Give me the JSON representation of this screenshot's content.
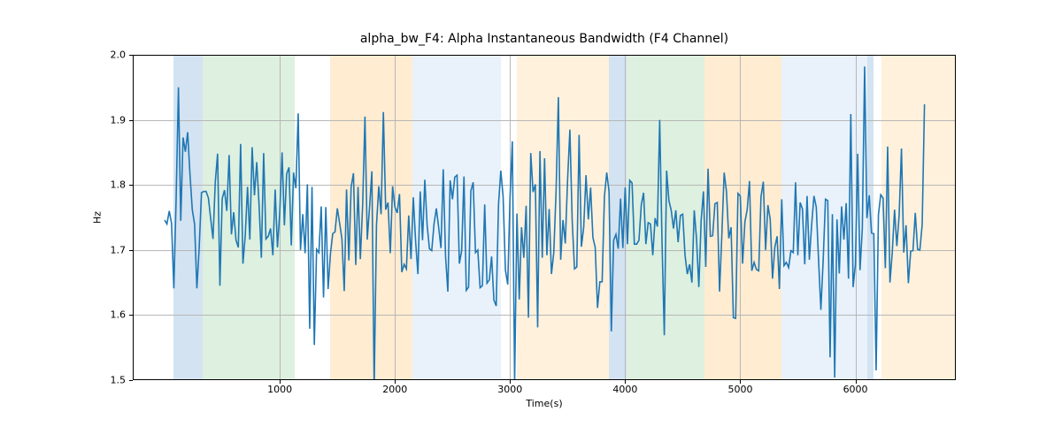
{
  "chart_data": {
    "type": "line",
    "title": "alpha_bw_F4: Alpha Instantaneous Bandwidth (F4 Channel)",
    "xlabel": "Time(s)",
    "ylabel": "Hz",
    "xlim": [
      -277,
      6872
    ],
    "ylim": [
      1.5,
      2.0
    ],
    "xticks": [
      1000,
      2000,
      3000,
      4000,
      5000,
      6000
    ],
    "yticks": [
      1.5,
      1.6,
      1.7,
      1.8,
      1.9,
      2.0
    ],
    "bands": [
      {
        "start": 80,
        "end": 330,
        "color": "#c6d9ec",
        "alpha": 0.75
      },
      {
        "start": 330,
        "end": 1130,
        "color": "#c8e6c9",
        "alpha": 0.6
      },
      {
        "start": 1440,
        "end": 2150,
        "color": "#ffe0b2",
        "alpha": 0.6
      },
      {
        "start": 2150,
        "end": 2920,
        "color": "#dbe9f6",
        "alpha": 0.6
      },
      {
        "start": 3060,
        "end": 3860,
        "color": "#ffe0b2",
        "alpha": 0.45
      },
      {
        "start": 3860,
        "end": 4010,
        "color": "#c6d9ec",
        "alpha": 0.75
      },
      {
        "start": 4010,
        "end": 4690,
        "color": "#c8e6c9",
        "alpha": 0.6
      },
      {
        "start": 4690,
        "end": 5360,
        "color": "#ffe0b2",
        "alpha": 0.6
      },
      {
        "start": 5360,
        "end": 6100,
        "color": "#dbe9f6",
        "alpha": 0.6
      },
      {
        "start": 6100,
        "end": 6160,
        "color": "#c6d9ec",
        "alpha": 0.75
      },
      {
        "start": 6230,
        "end": 6872,
        "color": "#ffe0b2",
        "alpha": 0.45
      }
    ],
    "series": [
      {
        "name": "alpha_bw_F4",
        "color": "#1f77b4",
        "x": [
          0,
          20,
          40,
          60,
          80,
          100,
          120,
          140,
          160,
          180,
          200,
          220,
          240,
          260,
          280,
          300,
          320,
          340,
          360,
          380,
          400,
          420,
          440,
          460,
          480,
          500,
          520,
          540,
          560,
          580,
          600,
          620,
          640,
          660,
          680,
          700,
          720,
          740,
          760,
          780,
          800,
          820,
          840,
          860,
          880,
          900,
          920,
          940,
          960,
          980,
          1000,
          1020,
          1040,
          1060,
          1080,
          1100,
          1120,
          1140,
          1160,
          1180,
          1200,
          1220,
          1240,
          1260,
          1280,
          1300,
          1320,
          1340,
          1360,
          1380,
          1400,
          1420,
          1440,
          1460,
          1480,
          1500,
          1520,
          1540,
          1560,
          1580,
          1600,
          1620,
          1640,
          1660,
          1680,
          1700,
          1720,
          1740,
          1760,
          1780,
          1800,
          1820,
          1840,
          1860,
          1880,
          1900,
          1920,
          1940,
          1960,
          1980,
          2000,
          2020,
          2040,
          2060,
          2080,
          2100,
          2120,
          2140,
          2160,
          2180,
          2200,
          2220,
          2240,
          2260,
          2280,
          2300,
          2320,
          2340,
          2360,
          2380,
          2400,
          2420,
          2440,
          2460,
          2480,
          2500,
          2520,
          2540,
          2560,
          2580,
          2600,
          2620,
          2640,
          2660,
          2680,
          2700,
          2720,
          2740,
          2760,
          2780,
          2800,
          2820,
          2840,
          2860,
          2880,
          2900,
          2920,
          2940,
          2960,
          2980,
          3000,
          3020,
          3040,
          3060,
          3080,
          3100,
          3120,
          3140,
          3160,
          3180,
          3200,
          3220,
          3240,
          3260,
          3280,
          3300,
          3320,
          3340,
          3360,
          3380,
          3400,
          3420,
          3440,
          3460,
          3480,
          3500,
          3520,
          3540,
          3560,
          3580,
          3600,
          3620,
          3640,
          3660,
          3680,
          3700,
          3720,
          3740,
          3760,
          3780,
          3800,
          3820,
          3840,
          3860,
          3880,
          3900,
          3920,
          3940,
          3960,
          3980,
          4000,
          4020,
          4040,
          4060,
          4080,
          4100,
          4120,
          4140,
          4160,
          4180,
          4200,
          4220,
          4240,
          4260,
          4280,
          4300,
          4320,
          4340,
          4360,
          4380,
          4400,
          4420,
          4440,
          4460,
          4480,
          4500,
          4520,
          4540,
          4560,
          4580,
          4600,
          4620,
          4640,
          4660,
          4680,
          4700,
          4720,
          4740,
          4760,
          4780,
          4800,
          4820,
          4840,
          4860,
          4880,
          4900,
          4920,
          4940,
          4960,
          4980,
          5000,
          5020,
          5040,
          5060,
          5080,
          5100,
          5120,
          5140,
          5160,
          5180,
          5200,
          5220,
          5240,
          5260,
          5280,
          5300,
          5320,
          5340,
          5360,
          5380,
          5400,
          5420,
          5440,
          5460,
          5480,
          5500,
          5520,
          5540,
          5560,
          5580,
          5600,
          5620,
          5640,
          5660,
          5680,
          5700,
          5720,
          5740,
          5760,
          5780,
          5800,
          5820,
          5840,
          5860,
          5880,
          5900,
          5920,
          5940,
          5960,
          5980,
          6000,
          6020,
          6040,
          6060,
          6080,
          6100,
          6120,
          6140,
          6160,
          6180,
          6200,
          6220,
          6240,
          6260,
          6280,
          6300,
          6320,
          6340,
          6360,
          6380,
          6400,
          6420,
          6440,
          6460,
          6480,
          6500,
          6520,
          6540,
          6560,
          6580,
          6600
        ],
        "y": [
          1.746,
          1.74,
          1.76,
          1.741,
          1.641,
          1.78,
          1.95,
          1.745,
          1.873,
          1.851,
          1.881,
          1.817,
          1.762,
          1.74,
          1.641,
          1.703,
          1.788,
          1.79,
          1.79,
          1.78,
          1.748,
          1.717,
          1.805,
          1.848,
          1.645,
          1.779,
          1.792,
          1.76,
          1.846,
          1.724,
          1.758,
          1.715,
          1.704,
          1.863,
          1.679,
          1.722,
          1.797,
          1.716,
          1.858,
          1.784,
          1.835,
          1.77,
          1.688,
          1.849,
          1.717,
          1.721,
          1.733,
          1.692,
          1.793,
          1.704,
          1.758,
          1.85,
          1.738,
          1.817,
          1.827,
          1.707,
          1.819,
          1.795,
          1.91,
          1.7,
          1.755,
          1.695,
          1.801,
          1.579,
          1.797,
          1.554,
          1.701,
          1.696,
          1.767,
          1.627,
          1.766,
          1.64,
          1.694,
          1.725,
          1.728,
          1.764,
          1.741,
          1.717,
          1.637,
          1.793,
          1.684,
          1.797,
          1.818,
          1.677,
          1.797,
          1.686,
          1.77,
          1.905,
          1.716,
          1.766,
          1.821,
          1.487,
          1.738,
          1.798,
          1.755,
          1.912,
          1.762,
          1.773,
          1.695,
          1.798,
          1.766,
          1.757,
          1.786,
          1.666,
          1.678,
          1.671,
          1.753,
          1.686,
          1.781,
          1.713,
          1.663,
          1.79,
          1.715,
          1.808,
          1.738,
          1.702,
          1.699,
          1.74,
          1.764,
          1.735,
          1.703,
          1.824,
          1.69,
          1.636,
          1.807,
          1.778,
          1.812,
          1.815,
          1.679,
          1.699,
          1.813,
          1.638,
          1.643,
          1.791,
          1.804,
          1.696,
          1.7,
          1.642,
          1.645,
          1.77,
          1.649,
          1.654,
          1.69,
          1.623,
          1.614,
          1.77,
          1.822,
          1.782,
          1.669,
          1.647,
          1.781,
          1.867,
          1.497,
          1.756,
          1.624,
          1.735,
          1.688,
          1.768,
          1.596,
          1.849,
          1.789,
          1.801,
          1.581,
          1.852,
          1.688,
          1.841,
          1.692,
          1.763,
          1.663,
          1.696,
          1.79,
          1.935,
          1.685,
          1.746,
          1.71,
          1.808,
          1.885,
          1.745,
          1.671,
          1.674,
          1.877,
          1.705,
          1.735,
          1.815,
          1.747,
          1.796,
          1.719,
          1.704,
          1.611,
          1.651,
          1.651,
          1.782,
          1.819,
          1.79,
          1.575,
          1.715,
          1.724,
          1.702,
          1.779,
          1.703,
          1.796,
          1.709,
          1.807,
          1.803,
          1.709,
          1.709,
          1.715,
          1.769,
          1.788,
          1.709,
          1.742,
          1.74,
          1.692,
          1.749,
          1.736,
          1.9,
          1.714,
          1.569,
          1.822,
          1.776,
          1.761,
          1.733,
          1.761,
          1.712,
          1.753,
          1.755,
          1.692,
          1.663,
          1.678,
          1.65,
          1.761,
          1.717,
          1.643,
          1.745,
          1.79,
          1.674,
          1.825,
          1.721,
          1.722,
          1.771,
          1.773,
          1.636,
          1.724,
          1.819,
          1.79,
          1.718,
          1.735,
          1.596,
          1.595,
          1.787,
          1.783,
          1.679,
          1.743,
          1.762,
          1.806,
          1.668,
          1.681,
          1.67,
          1.668,
          1.782,
          1.805,
          1.7,
          1.769,
          1.747,
          1.656,
          1.704,
          1.721,
          1.64,
          1.778,
          1.676,
          1.681,
          1.673,
          1.699,
          1.696,
          1.804,
          1.692,
          1.773,
          1.763,
          1.678,
          1.783,
          1.685,
          1.739,
          1.783,
          1.766,
          1.685,
          1.608,
          1.684,
          1.778,
          1.776,
          1.535,
          1.755,
          1.504,
          1.747,
          1.664,
          1.767,
          1.716,
          1.772,
          1.656,
          1.909,
          1.643,
          1.678,
          1.848,
          1.669,
          1.733,
          1.982,
          1.749,
          1.784,
          1.726,
          1.725,
          1.515,
          1.754,
          1.785,
          1.78,
          1.672,
          1.859,
          1.65,
          1.696,
          1.762,
          1.706,
          1.754,
          1.856,
          1.696,
          1.738,
          1.649,
          1.698,
          1.699,
          1.757,
          1.701,
          1.7,
          1.739,
          1.924
        ]
      }
    ]
  }
}
